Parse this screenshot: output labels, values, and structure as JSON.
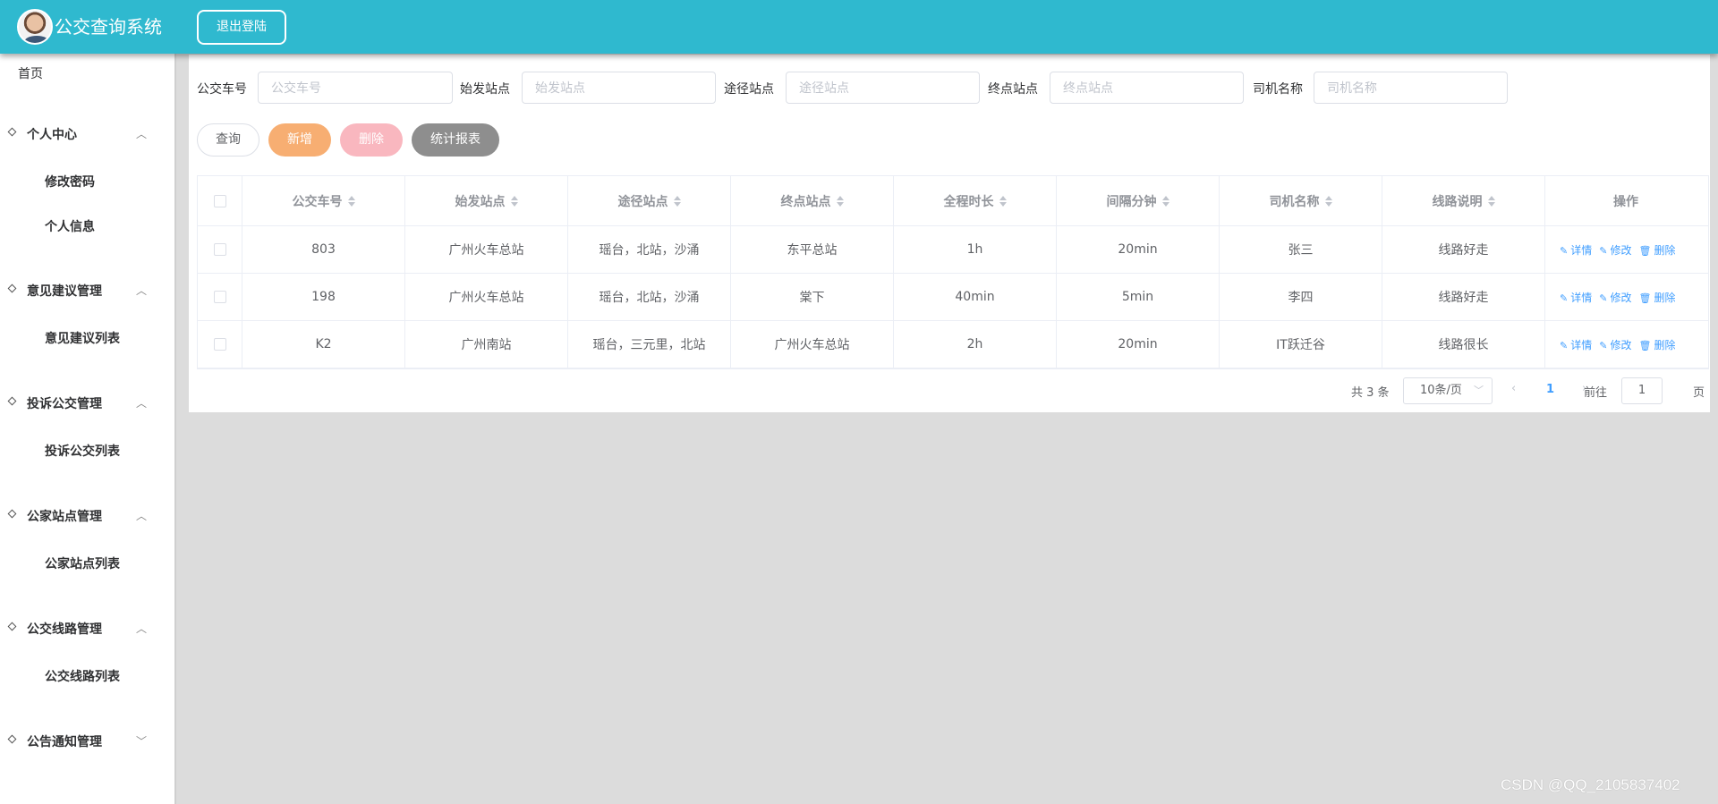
{
  "header": {
    "title": "公交查询系统",
    "logout_label": "退出登陆"
  },
  "sidebar": {
    "home": "首页",
    "menus": [
      {
        "title": "个人中心",
        "items": [
          "修改密码",
          "个人信息"
        ],
        "expanded": true
      },
      {
        "title": "意见建议管理",
        "items": [
          "意见建议列表"
        ],
        "expanded": true
      },
      {
        "title": "投诉公交管理",
        "items": [
          "投诉公交列表"
        ],
        "expanded": true
      },
      {
        "title": "公家站点管理",
        "items": [
          "公家站点列表"
        ],
        "expanded": true
      },
      {
        "title": "公交线路管理",
        "items": [
          "公交线路列表"
        ],
        "expanded": true
      },
      {
        "title": "公告通知管理",
        "items": [],
        "expanded": false
      }
    ]
  },
  "filters": [
    {
      "label": "公交车号",
      "placeholder": "公交车号"
    },
    {
      "label": "始发站点",
      "placeholder": "始发站点"
    },
    {
      "label": "途径站点",
      "placeholder": "途径站点"
    },
    {
      "label": "终点站点",
      "placeholder": "终点站点"
    },
    {
      "label": "司机名称",
      "placeholder": "司机名称"
    }
  ],
  "buttons": {
    "query": "查询",
    "add": "新增",
    "delete": "删除",
    "report": "统计报表"
  },
  "table": {
    "columns": [
      "公交车号",
      "始发站点",
      "途径站点",
      "终点站点",
      "全程时长",
      "间隔分钟",
      "司机名称",
      "线路说明"
    ],
    "ops_header": "操作",
    "rows": [
      [
        "803",
        "广州火车总站",
        "瑶台，北站，沙涌",
        "东平总站",
        "1h",
        "20min",
        "张三",
        "线路好走"
      ],
      [
        "198",
        "广州火车总站",
        "瑶台，北站，沙涌",
        "棠下",
        "40min",
        "5min",
        "李四",
        "线路好走"
      ],
      [
        "K2",
        "广州南站",
        "瑶台，三元里，北站",
        "广州火车总站",
        "2h",
        "20min",
        "IT跃迁谷",
        "线路很长"
      ]
    ],
    "ops": [
      "详情",
      "修改",
      "删除"
    ]
  },
  "pagination": {
    "total": "共 3 条",
    "page_size": "10条/页",
    "current_page": "1",
    "goto_label": "前往",
    "goto_value": "1",
    "page_suffix": "页"
  },
  "watermark": "CSDN @QQ_2105837402"
}
